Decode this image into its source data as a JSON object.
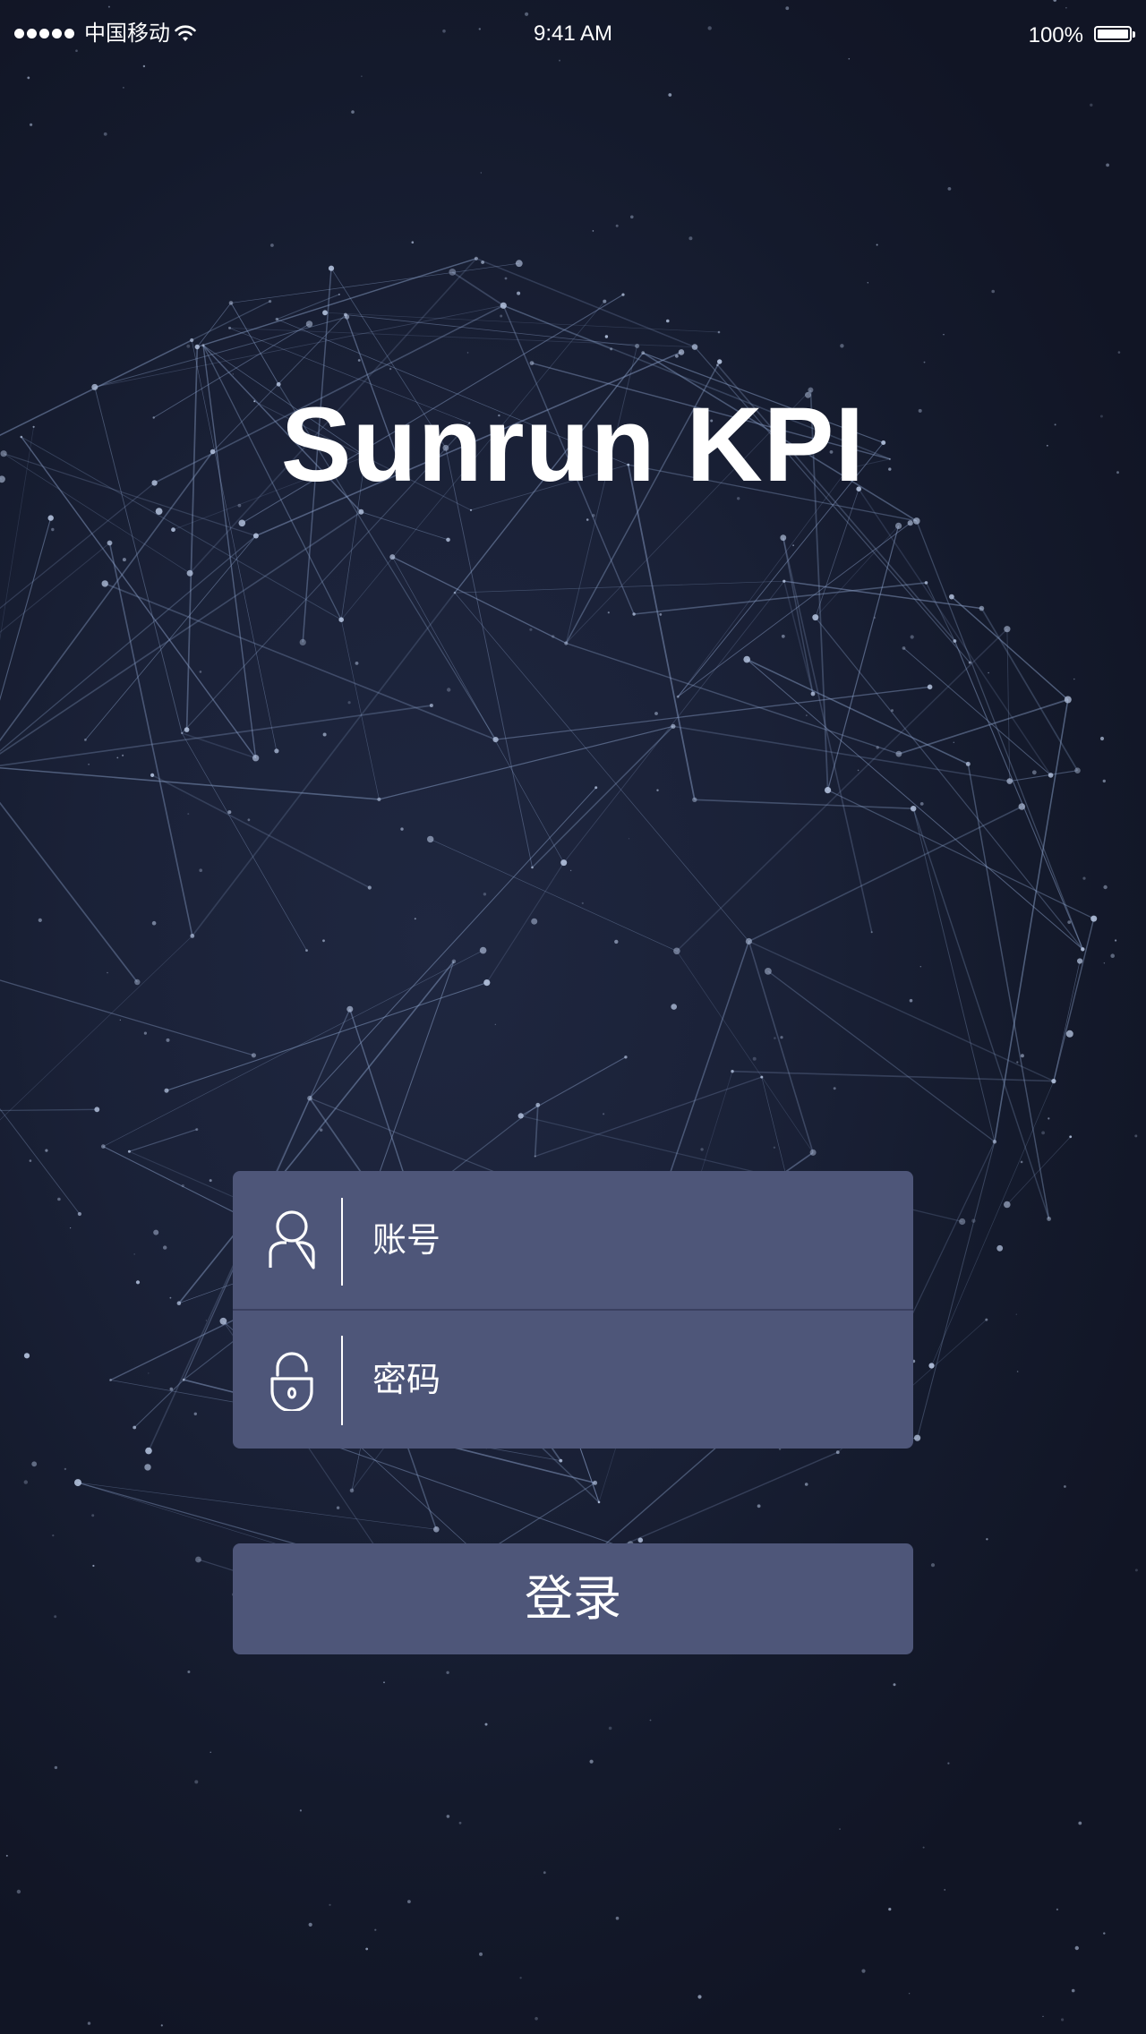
{
  "status_bar": {
    "carrier": "中国移动",
    "time": "9:41 AM",
    "battery_percent": "100%",
    "signal_icon": "signal-dots-icon",
    "wifi_icon": "wifi-icon",
    "battery_icon": "battery-icon"
  },
  "app": {
    "title": "Sunrun KPI"
  },
  "login_form": {
    "account": {
      "icon": "user-icon",
      "placeholder": "账号",
      "value": ""
    },
    "password": {
      "icon": "lock-icon",
      "placeholder": "密码",
      "value": ""
    },
    "submit_label": "登录"
  },
  "colors": {
    "background": "#151a2b",
    "field_background": "#4e5679",
    "field_divider": "#3a4060",
    "text": "#ffffff",
    "network_lines": "#8aa0c8"
  }
}
